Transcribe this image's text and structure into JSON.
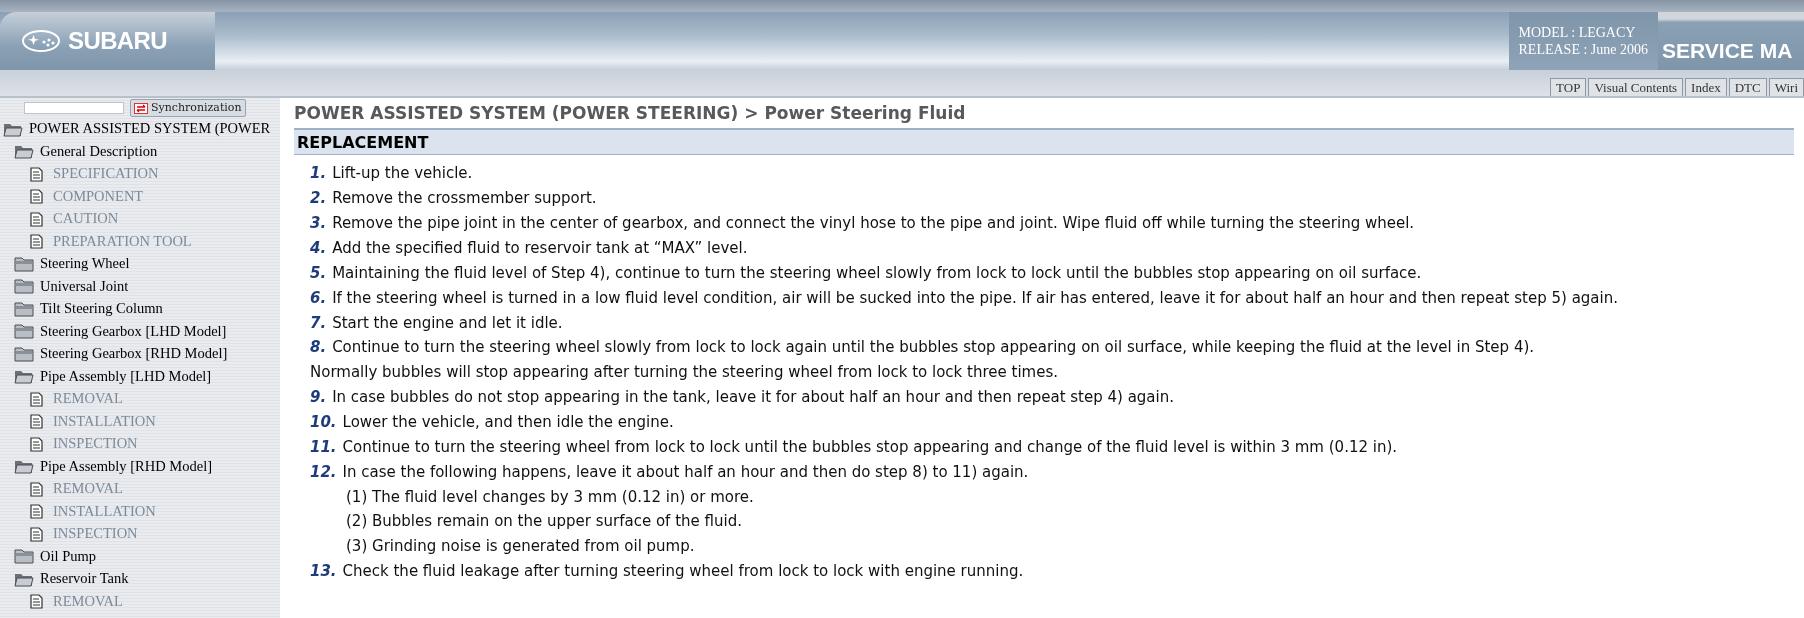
{
  "header": {
    "brand": "SUBARU",
    "model": "MODEL : LEGACY",
    "release": "RELEASE : June 2006",
    "title": "SERVICE MA"
  },
  "nav_tabs": [
    {
      "label": "TOP",
      "selected": false
    },
    {
      "label": "Visual Contents",
      "selected": false
    },
    {
      "label": "Index",
      "selected": false
    },
    {
      "label": "DTC",
      "selected": false
    },
    {
      "label": "Wiri",
      "selected": false
    }
  ],
  "sync_button": "Synchronization",
  "tree": [
    {
      "label": "POWER ASSISTED SYSTEM (POWER",
      "kind": "folder",
      "expanded": true,
      "children": [
        {
          "label": "General Description",
          "kind": "folder",
          "expanded": true,
          "children": [
            {
              "label": "SPECIFICATION",
              "kind": "page"
            },
            {
              "label": "COMPONENT",
              "kind": "page"
            },
            {
              "label": "CAUTION",
              "kind": "page"
            },
            {
              "label": "PREPARATION TOOL",
              "kind": "page"
            }
          ]
        },
        {
          "label": "Steering Wheel",
          "kind": "folder",
          "expanded": false
        },
        {
          "label": "Universal Joint",
          "kind": "folder",
          "expanded": false
        },
        {
          "label": "Tilt Steering Column",
          "kind": "folder",
          "expanded": false
        },
        {
          "label": "Steering Gearbox [LHD Model]",
          "kind": "folder",
          "expanded": false
        },
        {
          "label": "Steering Gearbox [RHD Model]",
          "kind": "folder",
          "expanded": false
        },
        {
          "label": "Pipe Assembly [LHD Model]",
          "kind": "folder",
          "expanded": true,
          "children": [
            {
              "label": "REMOVAL",
              "kind": "page"
            },
            {
              "label": "INSTALLATION",
              "kind": "page"
            },
            {
              "label": "INSPECTION",
              "kind": "page"
            }
          ]
        },
        {
          "label": "Pipe Assembly [RHD Model]",
          "kind": "folder",
          "expanded": true,
          "children": [
            {
              "label": "REMOVAL",
              "kind": "page"
            },
            {
              "label": "INSTALLATION",
              "kind": "page"
            },
            {
              "label": "INSPECTION",
              "kind": "page"
            }
          ]
        },
        {
          "label": "Oil Pump",
          "kind": "folder",
          "expanded": false
        },
        {
          "label": "Reservoir Tank",
          "kind": "folder",
          "expanded": true,
          "children": [
            {
              "label": "REMOVAL",
              "kind": "page"
            }
          ]
        }
      ]
    }
  ],
  "breadcrumb": "POWER ASSISTED SYSTEM (POWER STEERING) > Power Steering Fluid",
  "section_title": "REPLACEMENT",
  "steps": [
    {
      "kind": "step",
      "number": "1.",
      "text": "Lift-up the vehicle."
    },
    {
      "kind": "step",
      "number": "2.",
      "text": "Remove the crossmember support."
    },
    {
      "kind": "step",
      "number": "3.",
      "text": "Remove the pipe joint in the center of gearbox, and connect the vinyl hose to the pipe and joint. Wipe fluid off while turning the steering wheel."
    },
    {
      "kind": "step",
      "number": "4.",
      "text": "Add the specified fluid to reservoir tank at “MAX” level."
    },
    {
      "kind": "step",
      "number": "5.",
      "text": "Maintaining the fluid level of Step 4), continue to turn the steering wheel slowly from lock to lock until the bubbles stop appearing on oil surface."
    },
    {
      "kind": "step",
      "number": "6.",
      "text": "If the steering wheel is turned in a low fluid level condition, air will be sucked into the pipe. If air has entered, leave it for about half an hour and then repeat step 5) again."
    },
    {
      "kind": "step",
      "number": "7.",
      "text": "Start the engine and let it idle."
    },
    {
      "kind": "step",
      "number": "8.",
      "text": "Continue to turn the steering wheel slowly from lock to lock again until the bubbles stop appearing on oil surface, while keeping the fluid at the level in Step 4)."
    },
    {
      "kind": "note",
      "text": "Normally bubbles will stop appearing after turning the steering wheel from lock to lock three times."
    },
    {
      "kind": "step",
      "number": "9.",
      "text": "In case bubbles do not stop appearing in the tank, leave it for about half an hour and then repeat step 4) again."
    },
    {
      "kind": "step",
      "number": "10.",
      "text": "Lower the vehicle, and then idle the engine."
    },
    {
      "kind": "step",
      "number": "11.",
      "text": "Continue to turn the steering wheel from lock to lock until the bubbles stop appearing and change of the fluid level is within 3 mm (0.12 in)."
    },
    {
      "kind": "step",
      "number": "12.",
      "text": "In case the following happens, leave it about half an hour and then do step 8) to 11) again."
    },
    {
      "kind": "sub",
      "text": "(1) The fluid level changes by 3 mm (0.12 in) or more."
    },
    {
      "kind": "sub",
      "text": "(2) Bubbles remain on the upper surface of the fluid."
    },
    {
      "kind": "sub",
      "text": "(3) Grinding noise is generated from oil pump."
    },
    {
      "kind": "step",
      "number": "13.",
      "text": "Check the fluid leakage after turning steering wheel from lock to lock with engine running."
    }
  ]
}
